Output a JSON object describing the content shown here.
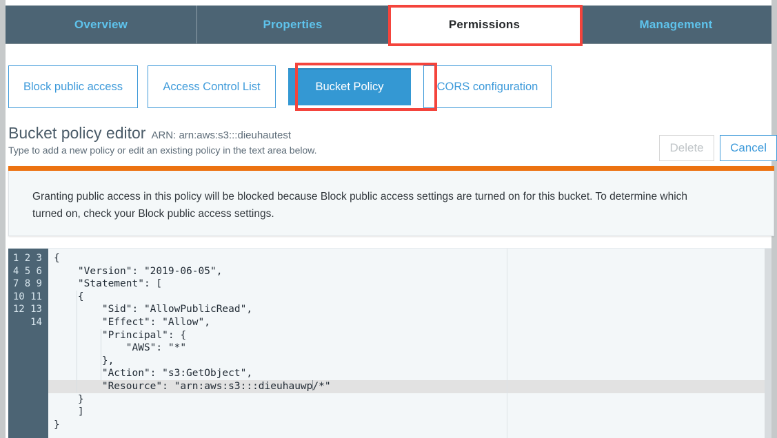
{
  "tabs": [
    {
      "label": "Overview",
      "active": false
    },
    {
      "label": "Properties",
      "active": false
    },
    {
      "label": "Permissions",
      "active": true
    },
    {
      "label": "Management",
      "active": false
    }
  ],
  "subtabs": [
    {
      "label": "Block public access",
      "selected": false
    },
    {
      "label": "Access Control List",
      "selected": false
    },
    {
      "label": "Bucket Policy",
      "selected": true
    },
    {
      "label": "CORS configuration",
      "selected": false
    }
  ],
  "editor_header": {
    "title": "Bucket policy editor",
    "arn": "ARN: arn:aws:s3:::dieuhautest",
    "subtitle": "Type to add a new policy or edit an existing policy in the text area below.",
    "delete_label": "Delete",
    "cancel_label": "Cancel"
  },
  "banner": {
    "text": "Granting public access in this policy will be blocked because Block public access settings are turned on for this bucket. To determine which\nturned on, check your Block public access settings.",
    "stripe_color": "#ec7211"
  },
  "code_editor": {
    "line_numbers": "1\n2\n3\n4\n5\n6\n7\n8\n9\n10\n11\n12\n13\n14",
    "lines": [
      "{",
      "    \"Version\": \"2019-06-05\",",
      "    \"Statement\": [",
      "    {",
      "        \"Sid\": \"AllowPublicRead\",",
      "        \"Effect\": \"Allow\",",
      "        \"Principal\": {",
      "            \"AWS\": \"*\"",
      "        },",
      "        \"Action\": \"s3:GetObject\",",
      "        \"Resource\": \"arn:aws:s3:::dieuhauwp",
      "    }",
      "    ]",
      "}"
    ],
    "active_line_number": 11,
    "caret_line_tail": "/*\"",
    "policy_version": "2019-06-05",
    "statement_sid": "AllowPublicRead",
    "statement_effect": "Allow",
    "statement_principal_aws": "*",
    "statement_action": "s3:GetObject",
    "statement_resource": "arn:aws:s3:::dieuhauwp/*"
  },
  "colors": {
    "tabbar": "#4c6474",
    "tab_link": "#5ec3ec",
    "button_blue": "#3498d3",
    "annotation_red": "#f4443c",
    "gutter": "#4c6474",
    "editor_bg": "#f3f7f9"
  }
}
